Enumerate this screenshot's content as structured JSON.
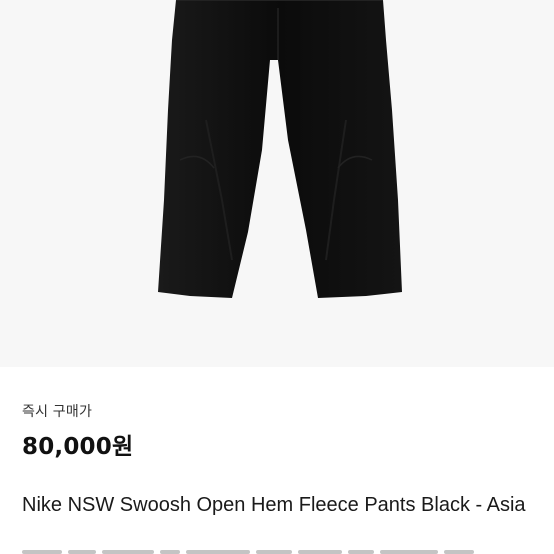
{
  "product": {
    "image_alt": "black fleece pants",
    "buy_label": "즉시 구매가",
    "price": "80,000원",
    "title": "Nike NSW Swoosh Open Hem Fleece Pants Black - Asia"
  },
  "colors": {
    "pants": "#0b0b0b",
    "background": "#f7f7f7",
    "text": "#111111"
  }
}
